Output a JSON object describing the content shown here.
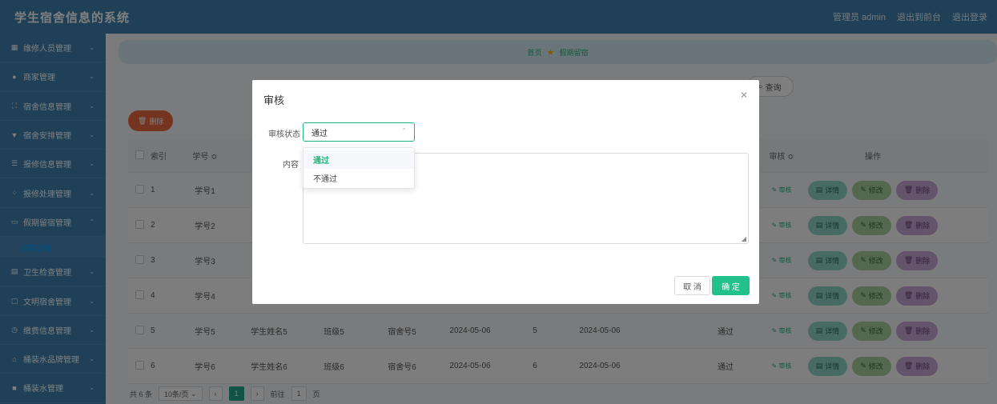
{
  "header": {
    "app_title": "学生宿舍信息的系统",
    "admin_label": "管理员 admin",
    "to_frontend": "退出到前台",
    "logout": "退出登录"
  },
  "sidebar": {
    "items": [
      {
        "label": "维修人员管理",
        "icon": "grid-icon"
      },
      {
        "label": "商家管理",
        "icon": "pin-icon"
      },
      {
        "label": "宿舍信息管理",
        "icon": "frame-icon"
      },
      {
        "label": "宿舍安排管理",
        "icon": "location-icon"
      },
      {
        "label": "报修信息管理",
        "icon": "list-icon"
      },
      {
        "label": "报修处理管理",
        "icon": "apps-icon"
      },
      {
        "label": "假期留宿管理",
        "icon": "monitor-icon"
      },
      {
        "label": "卫生检查管理",
        "icon": "doc-icon"
      },
      {
        "label": "文明宿舍管理",
        "icon": "chat-icon"
      },
      {
        "label": "缴费信息管理",
        "icon": "clock-icon"
      },
      {
        "label": "桶装水品牌管理",
        "icon": "bank-icon"
      },
      {
        "label": "桶装水管理",
        "icon": "box-icon"
      }
    ],
    "active_sub": "假期留宿"
  },
  "breadcrumb": {
    "home": "首页",
    "current": "假期留宿"
  },
  "toolbar": {
    "search_label": "查询",
    "bulk_delete_label": "删除"
  },
  "table": {
    "headers": {
      "index": "索引",
      "number": "学号 ≎",
      "audit": "审核 ≎",
      "ops": "操作"
    },
    "rows": [
      {
        "index": "1",
        "number": "学号1",
        "name": "",
        "class": "",
        "dorm": "",
        "date1": "",
        "days": "",
        "date2": "",
        "status": ""
      },
      {
        "index": "2",
        "number": "学号2",
        "name": "",
        "class": "",
        "dorm": "",
        "date1": "",
        "days": "",
        "date2": "",
        "status": ""
      },
      {
        "index": "3",
        "number": "学号3",
        "name": "",
        "class": "",
        "dorm": "",
        "date1": "",
        "days": "",
        "date2": "",
        "status": ""
      },
      {
        "index": "4",
        "number": "学号4",
        "name": "",
        "class": "",
        "dorm": "",
        "date1": "",
        "days": "",
        "date2": "",
        "status": ""
      },
      {
        "index": "5",
        "number": "学号5",
        "name": "学生姓名5",
        "class": "班级5",
        "dorm": "宿舍号5",
        "date1": "2024-05-06",
        "days": "5",
        "date2": "2024-05-06",
        "status": "通过"
      },
      {
        "index": "6",
        "number": "学号6",
        "name": "学生姓名6",
        "class": "班级6",
        "dorm": "宿舍号6",
        "date1": "2024-05-06",
        "days": "6",
        "date2": "2024-05-06",
        "status": "通过"
      }
    ],
    "audit_link": "审核",
    "op_detail": "详情",
    "op_edit": "修改",
    "op_delete": "删除"
  },
  "pager": {
    "total": "共 6 条",
    "page_size": "10条/页",
    "current_page": "1",
    "goto_prefix": "前往",
    "goto_value": "1",
    "goto_suffix": "页"
  },
  "dialog": {
    "title": "审核",
    "status_label": "审核状态",
    "status_value": "通过",
    "content_label": "内容",
    "cancel": "取 消",
    "confirm": "确 定"
  },
  "dropdown": {
    "options": [
      "通过",
      "不通过"
    ],
    "selected": "通过"
  },
  "colors": {
    "primary": "#3f80ae",
    "accent": "#22b47d",
    "danger": "#e8683f"
  }
}
